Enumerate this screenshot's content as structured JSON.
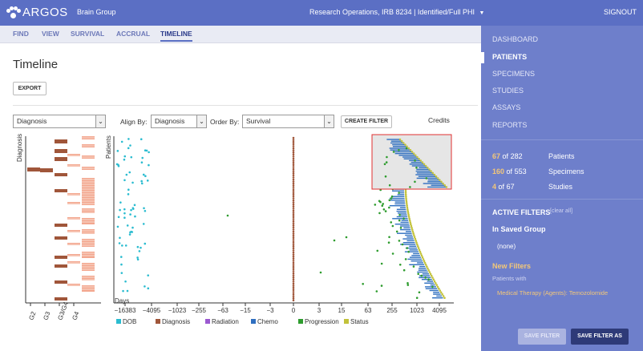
{
  "header": {
    "logo": "ARGOS",
    "group": "Brain Group",
    "study": "Research Operations, IRB 8234 | Identified/Full PHI",
    "signout": "SIGNOUT"
  },
  "tabs": [
    {
      "label": "FIND",
      "active": false
    },
    {
      "label": "VIEW",
      "active": false
    },
    {
      "label": "SURVIVAL",
      "active": false
    },
    {
      "label": "ACCRUAL",
      "active": false
    },
    {
      "label": "TIMELINE",
      "active": true
    }
  ],
  "sidebar": {
    "nav": [
      "DASHBOARD",
      "PATIENTS",
      "SPECIMENS",
      "STUDIES",
      "ASSAYS",
      "REPORTS"
    ],
    "active_nav": "PATIENTS",
    "stats": [
      {
        "count": "67",
        "total": "282",
        "label": "Patients"
      },
      {
        "count": "160",
        "total": "553",
        "label": "Specimens"
      },
      {
        "count": "4",
        "total": "67",
        "label": "Studies"
      }
    ],
    "of_word": "of",
    "active_filters_title": "ACTIVE FILTERS",
    "clear_all": "[clear all]",
    "saved_group_title": "In Saved Group",
    "saved_group_value": "(none)",
    "new_filters_title": "New Filters",
    "patients_with": "Patients with",
    "filter_text": "Medical Therapy (Agents): Temozolomide",
    "save_filter": "SAVE FILTER",
    "save_filter_as": "SAVE FILTER AS"
  },
  "main": {
    "title": "Timeline",
    "export": "EXPORT",
    "dataset_select": "Diagnosis",
    "align_label": "Align By:",
    "align_value": "Diagnosis",
    "order_label": "Order By:",
    "order_value": "Survival",
    "create_filter": "CREATE FILTER",
    "credits": "Credits"
  },
  "colors": {
    "accent": "#5b6fc4",
    "sidebar": "#6e7fcb",
    "dob": "#2bbcd0",
    "diagnosis": "#a0563a",
    "radiation": "#9b59d0",
    "chemo": "#2f6fc0",
    "progression": "#2e9c2e",
    "status": "#c2c23a",
    "grade_g4": "#f3a78f",
    "highlight": "#e03030"
  },
  "chart_data": [
    {
      "type": "heatmap",
      "ylabel": "Diagnosis",
      "categories": [
        "G2",
        "G3",
        "G3/G4",
        "G4"
      ]
    },
    {
      "type": "scatter",
      "ylabel": "Patients",
      "xlabel": "Days",
      "x_ticks": [
        "−16383",
        "−4095",
        "−1023",
        "−255",
        "−63",
        "−15",
        "−3",
        "0",
        "3",
        "15",
        "63",
        "255",
        "1023",
        "4095"
      ],
      "series": [
        {
          "name": "DOB"
        },
        {
          "name": "Diagnosis"
        },
        {
          "name": "Radiation"
        },
        {
          "name": "Chemo"
        },
        {
          "name": "Progression"
        },
        {
          "name": "Status"
        }
      ]
    }
  ]
}
